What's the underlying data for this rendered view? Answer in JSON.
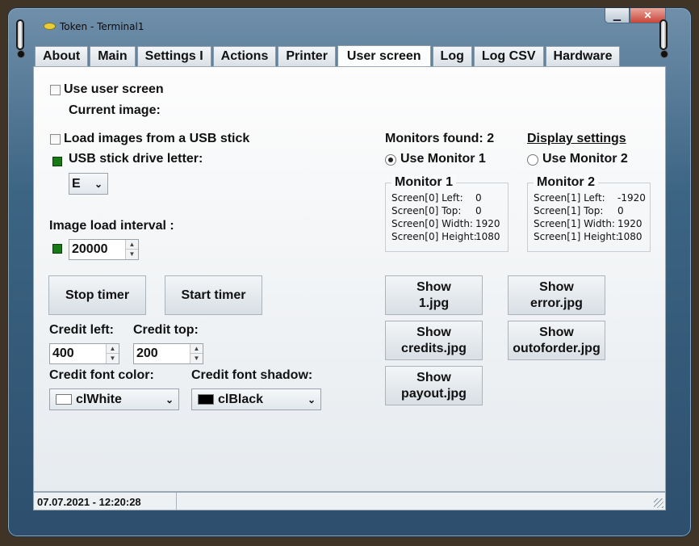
{
  "window": {
    "title": "Token - Terminal1",
    "minimize_glyph": "▁",
    "close_glyph": "✕"
  },
  "tabs": [
    "About",
    "Main",
    "Settings I",
    "Actions",
    "Printer",
    "User screen",
    "Log",
    "Log CSV",
    "Hardware"
  ],
  "active_tab": "User screen",
  "user_screen": {
    "use_user_screen_label": "Use user screen",
    "current_image_label": "Current image:",
    "load_usb_label": "Load images from a USB stick",
    "usb_drive_label": "USB stick drive letter:",
    "usb_drive_value": "E",
    "image_interval_label": "Image load interval :",
    "image_interval_value": "20000",
    "stop_timer": "Stop timer",
    "start_timer": "Start timer",
    "credit_left_label": "Credit left:",
    "credit_left_value": "400",
    "credit_top_label": "Credit top:",
    "credit_top_value": "200",
    "credit_font_color_label": "Credit font color:",
    "credit_font_color_value": "clWhite",
    "credit_font_color_swatch": "#ffffff",
    "credit_font_shadow_label": "Credit font shadow:",
    "credit_font_shadow_value": "clBlack",
    "credit_font_shadow_swatch": "#000000"
  },
  "monitors": {
    "found_label": "Monitors found: 2",
    "display_settings": "Display settings",
    "use_monitor_1": "Use Monitor 1",
    "use_monitor_2": "Use Monitor 2",
    "selected": 1,
    "monitor1": {
      "title": "Monitor 1",
      "rows": [
        {
          "k": "Screen[0] Left:",
          "v": "0"
        },
        {
          "k": "Screen[0] Top:",
          "v": "0"
        },
        {
          "k": "Screen[0] Width:",
          "v": "1920"
        },
        {
          "k": "Screen[0] Height:",
          "v": "1080"
        }
      ]
    },
    "monitor2": {
      "title": "Monitor 2",
      "rows": [
        {
          "k": "Screen[1] Left:",
          "v": "-1920"
        },
        {
          "k": "Screen[1] Top:",
          "v": "0"
        },
        {
          "k": "Screen[1] Width:",
          "v": "1920"
        },
        {
          "k": "Screen[1] Height:",
          "v": "1080"
        }
      ]
    }
  },
  "show_buttons": {
    "b1": [
      "Show",
      "1.jpg"
    ],
    "b2": [
      "Show",
      "error.jpg"
    ],
    "b3": [
      "Show",
      "credits.jpg"
    ],
    "b4": [
      "Show",
      "outoforder.jpg"
    ],
    "b5": [
      "Show",
      "payout.jpg"
    ]
  },
  "status_bar": {
    "datetime": "07.07.2021 - 12:20:28"
  },
  "colors": {
    "led_green": "#177a17",
    "window_frame": "#3c6483"
  }
}
